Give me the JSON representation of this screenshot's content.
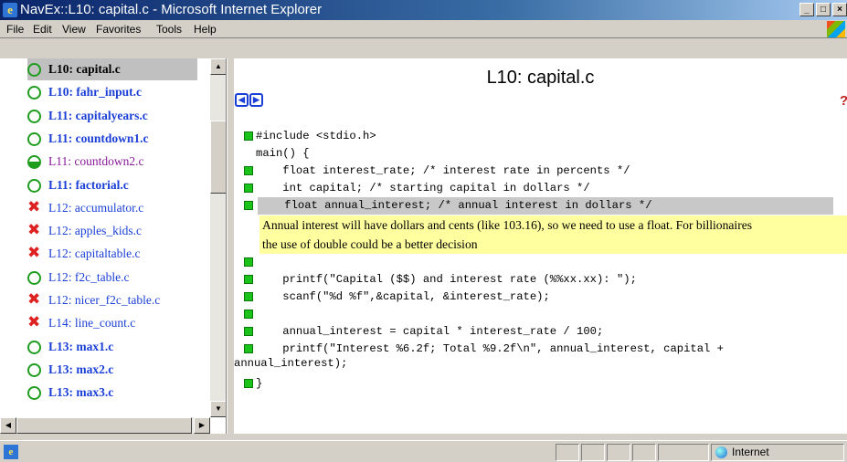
{
  "window": {
    "title": "NavEx::L10: capital.c - Microsoft Internet Explorer"
  },
  "menu": [
    "File",
    "Edit",
    "View",
    "Favorites",
    "Tools",
    "Help"
  ],
  "toc": [
    {
      "label": "L10: capital.c",
      "status": "open",
      "style": "link-bold",
      "selected": true
    },
    {
      "label": "L10: fahr_input.c",
      "status": "open",
      "style": "link-bold"
    },
    {
      "label": "L11: capitalyears.c",
      "status": "open",
      "style": "link-bold"
    },
    {
      "label": "L11: countdown1.c",
      "status": "open",
      "style": "link-bold"
    },
    {
      "label": "L11: countdown2.c",
      "status": "half",
      "style": "visited"
    },
    {
      "label": "L11: factorial.c",
      "status": "open",
      "style": "link-bold"
    },
    {
      "label": "L12: accumulator.c",
      "status": "x",
      "style": "link"
    },
    {
      "label": "L12: apples_kids.c",
      "status": "x",
      "style": "link"
    },
    {
      "label": "L12: capitaltable.c",
      "status": "x",
      "style": "link"
    },
    {
      "label": "L12: f2c_table.c",
      "status": "open",
      "style": "link"
    },
    {
      "label": "L12: nicer_f2c_table.c",
      "status": "x",
      "style": "link"
    },
    {
      "label": "L14: line_count.c",
      "status": "x",
      "style": "link"
    },
    {
      "label": "L13: max1.c",
      "status": "open",
      "style": "link-bold"
    },
    {
      "label": "L13: max2.c",
      "status": "open",
      "style": "link-bold"
    },
    {
      "label": "L13: max3.c",
      "status": "open",
      "style": "link-bold"
    }
  ],
  "page": {
    "title": "L10: capital.c",
    "help_icon": "?",
    "nav_icons": [
      "back-icon",
      "forward-icon"
    ]
  },
  "code": [
    {
      "text": "#include <stdio.h>",
      "marker": true
    },
    {
      "text": "main() {",
      "marker": false
    },
    {
      "text": "    float interest_rate; /* interest rate in percents */",
      "marker": true
    },
    {
      "text": "    int capital; /* starting capital in dollars */",
      "marker": true
    },
    {
      "text": "    float annual_interest; /* annual interest in dollars */",
      "marker": true,
      "highlight": true
    },
    {
      "text": "",
      "marker": true
    },
    {
      "text": "    printf(\"Capital ($$) and interest rate (%%xx.xx): \");",
      "marker": true
    },
    {
      "text": "    scanf(\"%d %f\",&capital, &interest_rate);",
      "marker": true
    },
    {
      "text": "",
      "marker": true
    },
    {
      "text": "    annual_interest = capital * interest_rate / 100;",
      "marker": true
    },
    {
      "text": "    printf(\"Interest %6.2f; Total %9.2f\\n\", annual_interest, capital +",
      "marker": true
    },
    {
      "text": "annual_interest);",
      "marker": false
    },
    {
      "text": "}",
      "marker": true
    }
  ],
  "annotation": {
    "line1": "Annual interest will have dollars and cents (like 103.16), so we need to use a float. For billionaires",
    "line2": "the use of double could be a better decision"
  },
  "status": {
    "zone": "Internet"
  }
}
